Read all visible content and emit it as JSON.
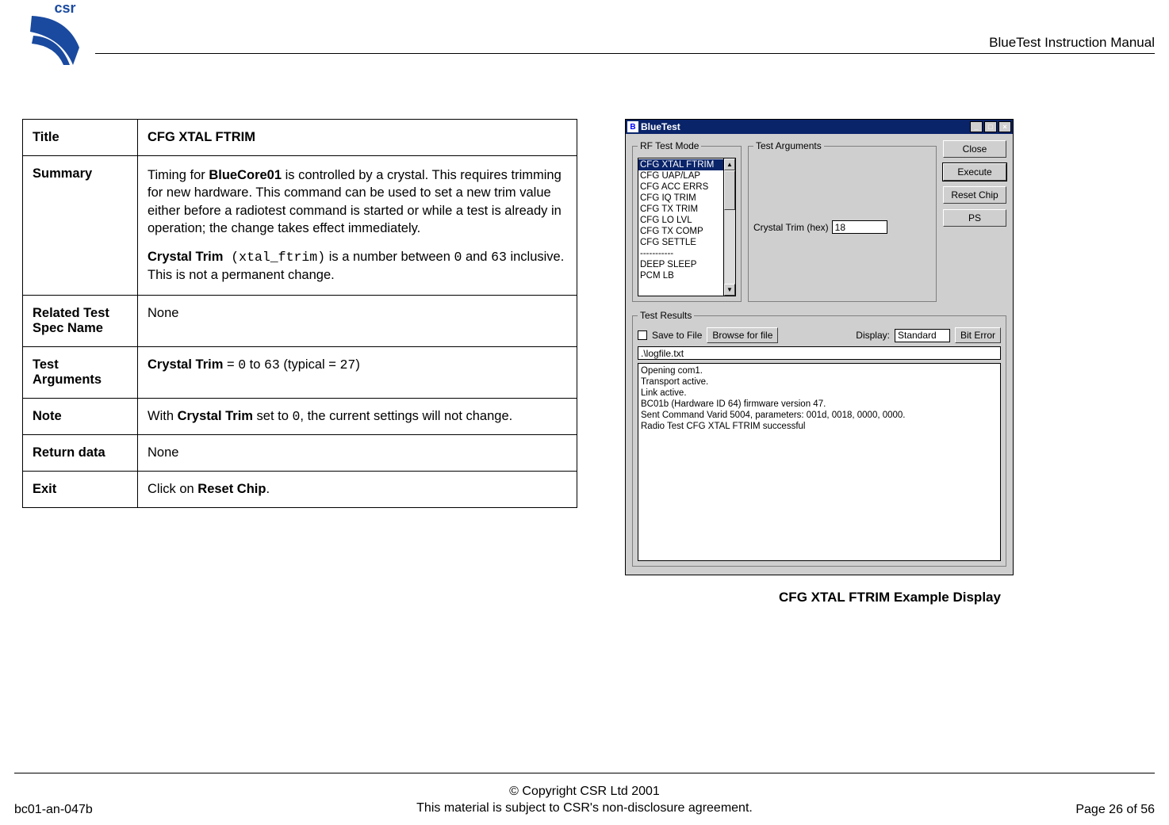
{
  "header": {
    "doc_title": "BlueTest Instruction Manual",
    "logo_text": "csr"
  },
  "spec": {
    "rows": {
      "title": {
        "key": "Title",
        "val": "CFG XTAL FTRIM"
      },
      "summary": {
        "key": "Summary",
        "p1_pre": "Timing for ",
        "p1_bold": "BlueCore01",
        "p1_post": " is controlled by a crystal. This requires trimming for new hardware. This command can be used to set a new trim value either before a radiotest command is started or while a test is already in operation; the change takes effect immediately.",
        "p2_bold": "Crystal Trim",
        "p2_code1": " (xtal_ftrim)",
        "p2_mid": " is a number between ",
        "p2_code2": "0",
        "p2_and": " and ",
        "p2_code3": "63",
        "p2_post": " inclusive. This is not a permanent change."
      },
      "related": {
        "key": "Related Test Spec Name",
        "val": "None"
      },
      "testargs": {
        "key": "Test Arguments",
        "b1": "Crystal Trim",
        "t1": " = ",
        "c1": "0",
        "t2": " to ",
        "c2": "63",
        "t3": " (typical = ",
        "c3": "27",
        "t4": ")"
      },
      "note": {
        "key": "Note",
        "t1": "With ",
        "b1": "Crystal Trim",
        "t2": " set to ",
        "c1": "0",
        "t3": ", the current settings will not change."
      },
      "return": {
        "key": "Return data",
        "val": "None"
      },
      "exit": {
        "key": "Exit",
        "t1": "Click on ",
        "b1": "Reset Chip",
        "t2": "."
      }
    }
  },
  "bluetest": {
    "title": "BlueTest",
    "groups": {
      "rf_mode": "RF Test Mode",
      "test_args": "Test Arguments",
      "results": "Test Results"
    },
    "rf_items": [
      "CFG XTAL FTRIM",
      "CFG UAP/LAP",
      "CFG ACC ERRS",
      "CFG IQ TRIM",
      "CFG TX TRIM",
      "CFG LO LVL",
      "CFG TX COMP",
      "CFG SETTLE",
      "-----------",
      "DEEP SLEEP",
      "PCM LB"
    ],
    "rf_selected_index": 0,
    "arg_label": "Crystal Trim (hex)",
    "arg_value": "18",
    "buttons": {
      "close": "Close",
      "execute": "Execute",
      "reset": "Reset Chip",
      "ps": "PS"
    },
    "results_row": {
      "save_label": "Save to File",
      "browse": "Browse for file",
      "display_label": "Display:",
      "display_value": "Standard",
      "bit_error": "Bit Error"
    },
    "logfile_path": ".\\logfile.txt",
    "log_lines": [
      "Opening com1.",
      "Transport active.",
      "Link active.",
      "BC01b (Hardware ID 64) firmware version 47.",
      "Sent Command Varid 5004, parameters: 001d, 0018, 0000, 0000.",
      "Radio Test CFG XTAL FTRIM successful"
    ]
  },
  "figure_caption": "CFG XTAL FTRIM Example Display",
  "footer": {
    "doc_id": "bc01-an-047b",
    "copyright": "© Copyright CSR Ltd 2001",
    "nda": "This material is subject to CSR's non-disclosure agreement.",
    "page": "Page 26 of 56"
  }
}
